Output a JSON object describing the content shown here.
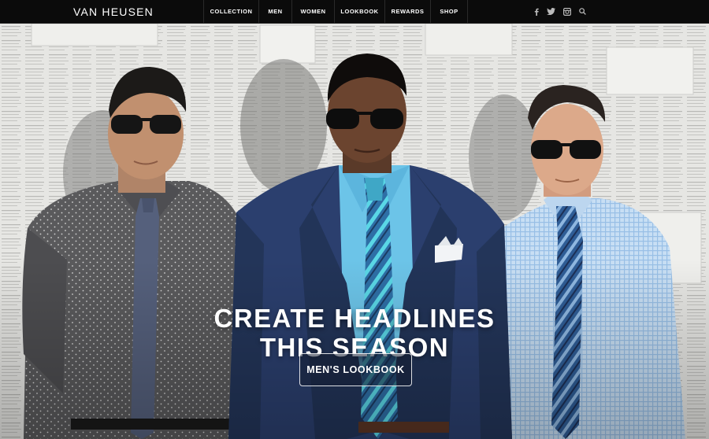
{
  "brand": {
    "logo_text": "VAN HEUSEN"
  },
  "nav": {
    "items": [
      {
        "label": "COLLECTION"
      },
      {
        "label": "MEN"
      },
      {
        "label": "WOMEN"
      },
      {
        "label": "LOOKBOOK"
      },
      {
        "label": "REWARDS"
      },
      {
        "label": "SHOP"
      }
    ],
    "social_icons": [
      "facebook-icon",
      "twitter-icon",
      "instagram-icon",
      "search-icon"
    ]
  },
  "hero": {
    "headline_line1": "CREATE HEADLINES",
    "headline_line2": "THIS SEASON",
    "cta_label": "MEN'S LOOKBOOK",
    "colors": {
      "navbar": "#0b0b0b",
      "suit_navy": "#2b3f6e",
      "shirt_blue": "#6cc4e8",
      "shirt_gray": "#5a5a5c",
      "shirt_light": "#b9d6f0"
    }
  }
}
